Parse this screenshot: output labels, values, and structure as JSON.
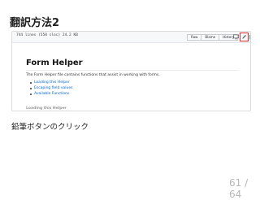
{
  "slide": {
    "title": "翻訳方法2",
    "caption": "鉛筆ボタンのクリック",
    "page_number": "61 / 64"
  },
  "file_header": {
    "info": "744 lines (558 sloc)  24.2 KB",
    "buttons": [
      "Raw",
      "Blame",
      "History"
    ],
    "icons": [
      "desktop-icon",
      "pencil-icon",
      "trash-icon"
    ],
    "highlight_color": "#e03030"
  },
  "doc": {
    "title": "Form Helper",
    "intro": "The Form Helper file contains functions that assist in working with forms.",
    "links": [
      "Loading this Helper",
      "Escaping field values",
      "Available Functions"
    ],
    "cut_off_text": "Loading this Helper"
  }
}
